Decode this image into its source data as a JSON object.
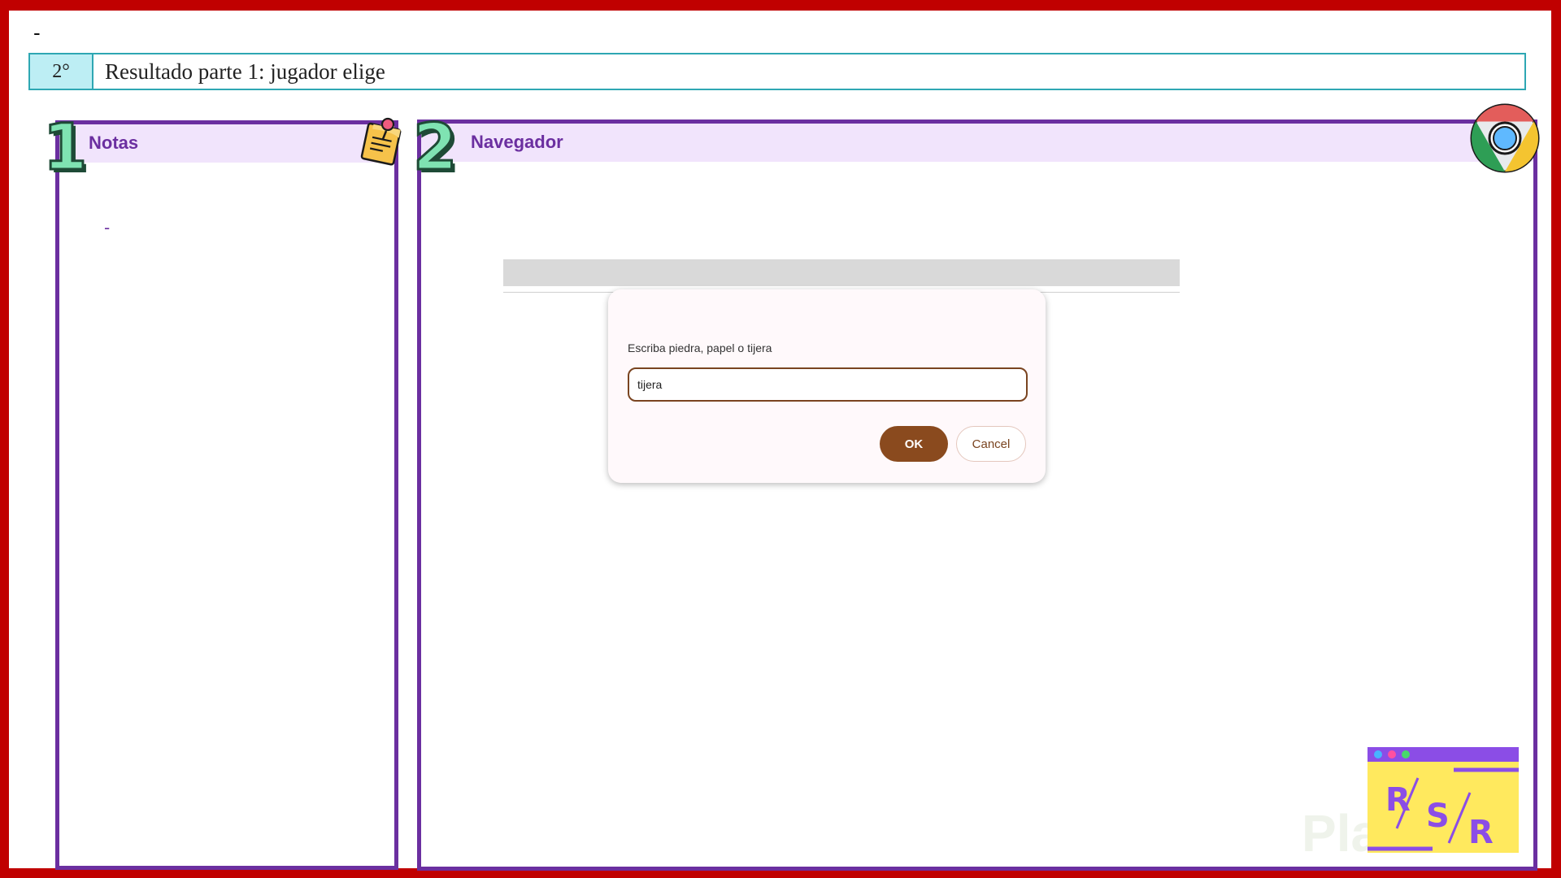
{
  "slide": {
    "top_dash": "-",
    "header": {
      "step": "2°",
      "title": "Resultado parte 1: jugador elige"
    }
  },
  "notes_panel": {
    "number": "1",
    "title": "Notas",
    "content": "-",
    "icon": "sticky-note-icon"
  },
  "browser_panel": {
    "number": "2",
    "title": "Navegador",
    "icon": "chrome-icon",
    "prompt_dialog": {
      "message": "Escriba piedra, papel o tijera",
      "input_value": "tijera",
      "ok_label": "OK",
      "cancel_label": "Cancel"
    }
  },
  "brand_logo": {
    "letters": [
      "R",
      "S",
      "R"
    ],
    "watermark": "Platzi"
  },
  "colors": {
    "frame": "#c00000",
    "panel_border": "#6b2fa0",
    "panel_header_bg": "#f1e4fc",
    "header_border": "#2ea7b3",
    "step_bg": "#bdeef4",
    "ok_button": "#8a4a1e"
  }
}
